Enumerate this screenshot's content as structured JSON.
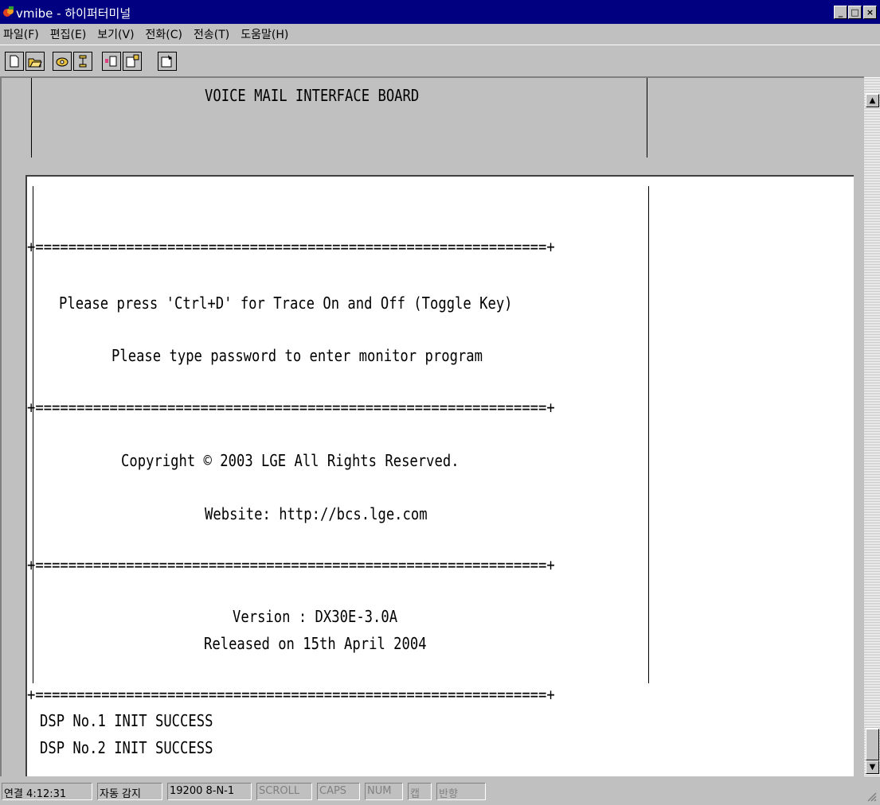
{
  "window": {
    "title": "vmibe - 하이퍼터미널",
    "minimize": "_",
    "maximize": "□",
    "close": "×"
  },
  "menu": [
    {
      "label": "파일(F)"
    },
    {
      "label": "편집(E)"
    },
    {
      "label": "보기(V)"
    },
    {
      "label": "전화(C)"
    },
    {
      "label": "전송(T)"
    },
    {
      "label": "도움말(H)"
    }
  ],
  "toolbar": {
    "buttons": [
      "new-icon",
      "open-icon",
      "call-icon",
      "disconnect-icon",
      "send-icon",
      "receive-icon",
      "properties-icon"
    ]
  },
  "terminal": {
    "header_line": "VOICE MAIL INTERFACE BOARD",
    "separator": "+==============================================================+",
    "trace_line": "Please press 'Ctrl+D' for Trace On and Off (Toggle Key)",
    "password_line": "Please type password to enter monitor program",
    "copyright_line": "Copyright © 2003 LGE All Rights Reserved.",
    "website_line": "Website: http://bcs.lge.com",
    "version_line": "Version : DX30E-3.0A",
    "release_line": "Released on 15th April 2004",
    "dsp1": "DSP No.1 INIT SUCCESS",
    "dsp2": "DSP No.2 INIT SUCCESS"
  },
  "scrollbar": {
    "up": "▲",
    "down": "▼"
  },
  "status": {
    "connection": "연결 4:12:31",
    "detect": "자동 감지",
    "port": "19200 8-N-1",
    "scroll": "SCROLL",
    "caps": "CAPS",
    "num": "NUM",
    "capture": "캡",
    "echo": "반향"
  }
}
